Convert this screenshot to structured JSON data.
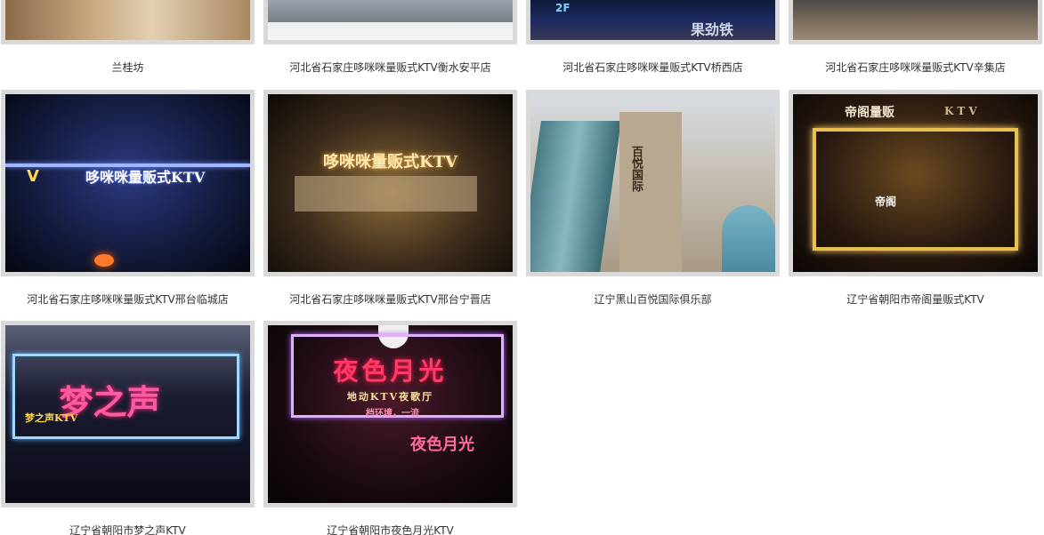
{
  "gallery": {
    "items": [
      {
        "caption": "兰桂坊"
      },
      {
        "caption": "河北省石家庄哆咪咪量贩式KTV衡水安平店"
      },
      {
        "caption": "河北省石家庄哆咪咪量贩式KTV桥西店"
      },
      {
        "caption": "河北省石家庄哆咪咪量贩式KTV辛集店"
      },
      {
        "caption": "河北省石家庄哆咪咪量贩式KTV邢台临城店"
      },
      {
        "caption": "河北省石家庄哆咪咪量贩式KTV邢台宁晋店"
      },
      {
        "caption": "辽宁黑山百悦国际俱乐部"
      },
      {
        "caption": "辽宁省朝阳市帝阁量贩式KTV"
      },
      {
        "caption": "辽宁省朝阳市梦之声KTV"
      },
      {
        "caption": "辽宁省朝阳市夜色月光KTV"
      }
    ]
  },
  "signs": {
    "qiaoxi_2f": "2F",
    "qiaoxi_brand": "果劲铁",
    "lincheng_sign": "哆咪咪量贩式KTV",
    "lincheng_v": "V",
    "ningjin_sign": "哆咪咪量贩式KTV",
    "heishan_sign": "百悦国际",
    "diguo_sign": "帝阁量贩",
    "diguo_ktv": "KTV",
    "diguo_door": "帝阁",
    "meng_sign": "梦之声",
    "meng_sub": "梦之声KTV",
    "yese_sign": "夜色月光",
    "yese_sub": "地动KTV夜歌厅",
    "yese_slogan": "档环境，一流",
    "yese_door": "夜色月光"
  }
}
